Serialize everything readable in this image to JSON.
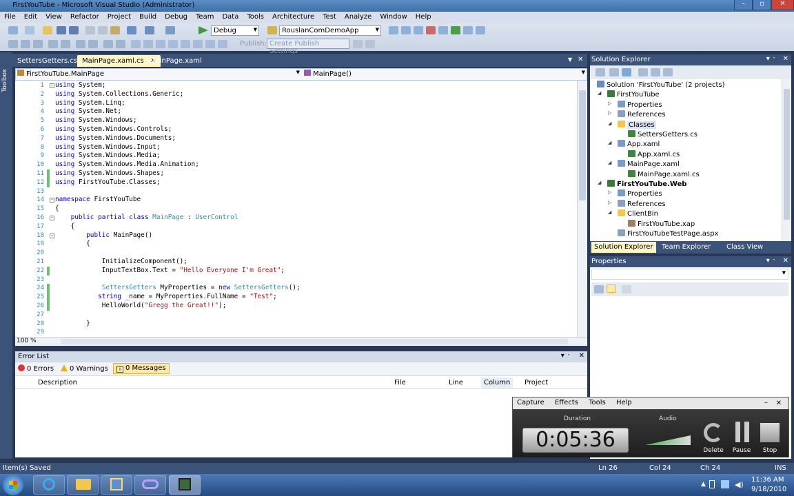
{
  "window": {
    "title": "FirstYouTube - Microsoft Visual Studio (Administrator)"
  },
  "menu": [
    "File",
    "Edit",
    "View",
    "Refactor",
    "Project",
    "Build",
    "Debug",
    "Team",
    "Data",
    "Tools",
    "Architecture",
    "Test",
    "Analyze",
    "Window",
    "Help"
  ],
  "toolbar": {
    "config": "Debug",
    "project": "RouslanComDemoApp",
    "publish_label": "Publish:",
    "publish_settings": "Create Publish Settings"
  },
  "sidebar_label": "Toolbox",
  "tabs": [
    {
      "label": "SettersGetters.cs"
    },
    {
      "label": "MainPage.xaml.cs"
    },
    {
      "label": "MainPage.xaml"
    }
  ],
  "nav": {
    "left": "FirstYouTube.MainPage",
    "right": "MainPage()"
  },
  "code_lines": [
    {
      "n": "1",
      "t": "using System;"
    },
    {
      "n": "2",
      "t": "using System.Collections.Generic;"
    },
    {
      "n": "3",
      "t": "using System.Linq;"
    },
    {
      "n": "4",
      "t": "using System.Net;"
    },
    {
      "n": "5",
      "t": "using System.Windows;"
    },
    {
      "n": "6",
      "t": "using System.Windows.Controls;"
    },
    {
      "n": "7",
      "t": "using System.Windows.Documents;"
    },
    {
      "n": "8",
      "t": "using System.Windows.Input;"
    },
    {
      "n": "9",
      "t": "using System.Windows.Media;"
    },
    {
      "n": "10",
      "t": "using System.Windows.Media.Animation;"
    },
    {
      "n": "11",
      "t": "using System.Windows.Shapes;"
    },
    {
      "n": "12",
      "t": "using FirstYouTube.Classes;"
    },
    {
      "n": "13",
      "t": ""
    },
    {
      "n": "14",
      "t": "namespace FirstYouTube"
    },
    {
      "n": "15",
      "t": "{"
    },
    {
      "n": "16",
      "t": "    public partial class MainPage : UserControl"
    },
    {
      "n": "17",
      "t": "    {"
    },
    {
      "n": "18",
      "t": "        public MainPage()"
    },
    {
      "n": "19",
      "t": "        {"
    },
    {
      "n": "20",
      "t": ""
    },
    {
      "n": "21",
      "t": "            InitializeComponent();"
    },
    {
      "n": "22",
      "t": "            InputTextBox.Text = \"Hello Everyone I'm Great\";"
    },
    {
      "n": "23",
      "t": ""
    },
    {
      "n": "24",
      "t": "            SettersGetters MyProperties = new SettersGetters();"
    },
    {
      "n": "25",
      "t": "           string _name = MyProperties.FullName = \"Test\";"
    },
    {
      "n": "26",
      "t": "            HelloWorld(\"Gregg the Great!!\");"
    },
    {
      "n": "27",
      "t": ""
    },
    {
      "n": "28",
      "t": "        }"
    },
    {
      "n": "29",
      "t": ""
    }
  ],
  "zoom": "100 %",
  "error_list": {
    "title": "Error List",
    "errors": "0 Errors",
    "warnings": "0 Warnings",
    "messages": "0 Messages",
    "columns": [
      "Description",
      "File",
      "Line",
      "Column",
      "Project"
    ]
  },
  "solution_explorer": {
    "title": "Solution Explorer",
    "items": [
      "Solution 'FirstYouTube' (2 projects)",
      "FirstYouTube",
      "Properties",
      "References",
      "Classes",
      "SettersGetters.cs",
      "App.xaml",
      "App.xaml.cs",
      "MainPage.xaml",
      "MainPage.xaml.cs",
      "FirstYouTube.Web",
      "Properties",
      "References",
      "ClientBin",
      "FirstYouTube.xap",
      "FirstYouTubeTestPage.aspx"
    ],
    "bottom_tabs": [
      "Solution Explorer",
      "Team Explorer",
      "Class View"
    ]
  },
  "properties": {
    "title": "Properties"
  },
  "status": {
    "left": "Item(s) Saved",
    "ln": "Ln 26",
    "col": "Col 24",
    "ch": "Ch 24",
    "mode": "INS"
  },
  "recorder": {
    "menu": [
      "Capture",
      "Effects",
      "Tools",
      "Help"
    ],
    "duration_label": "Duration",
    "audio_label": "Audio",
    "time": "0:05:36",
    "delete": "Delete",
    "pause": "Pause",
    "stop": "Stop"
  },
  "tray": {
    "time": "11:36 AM",
    "date": "9/18/2010"
  },
  "colors": {
    "keyword": "#0000ff",
    "type": "#2b91af",
    "string": "#a31515",
    "chrome": "#293955"
  }
}
